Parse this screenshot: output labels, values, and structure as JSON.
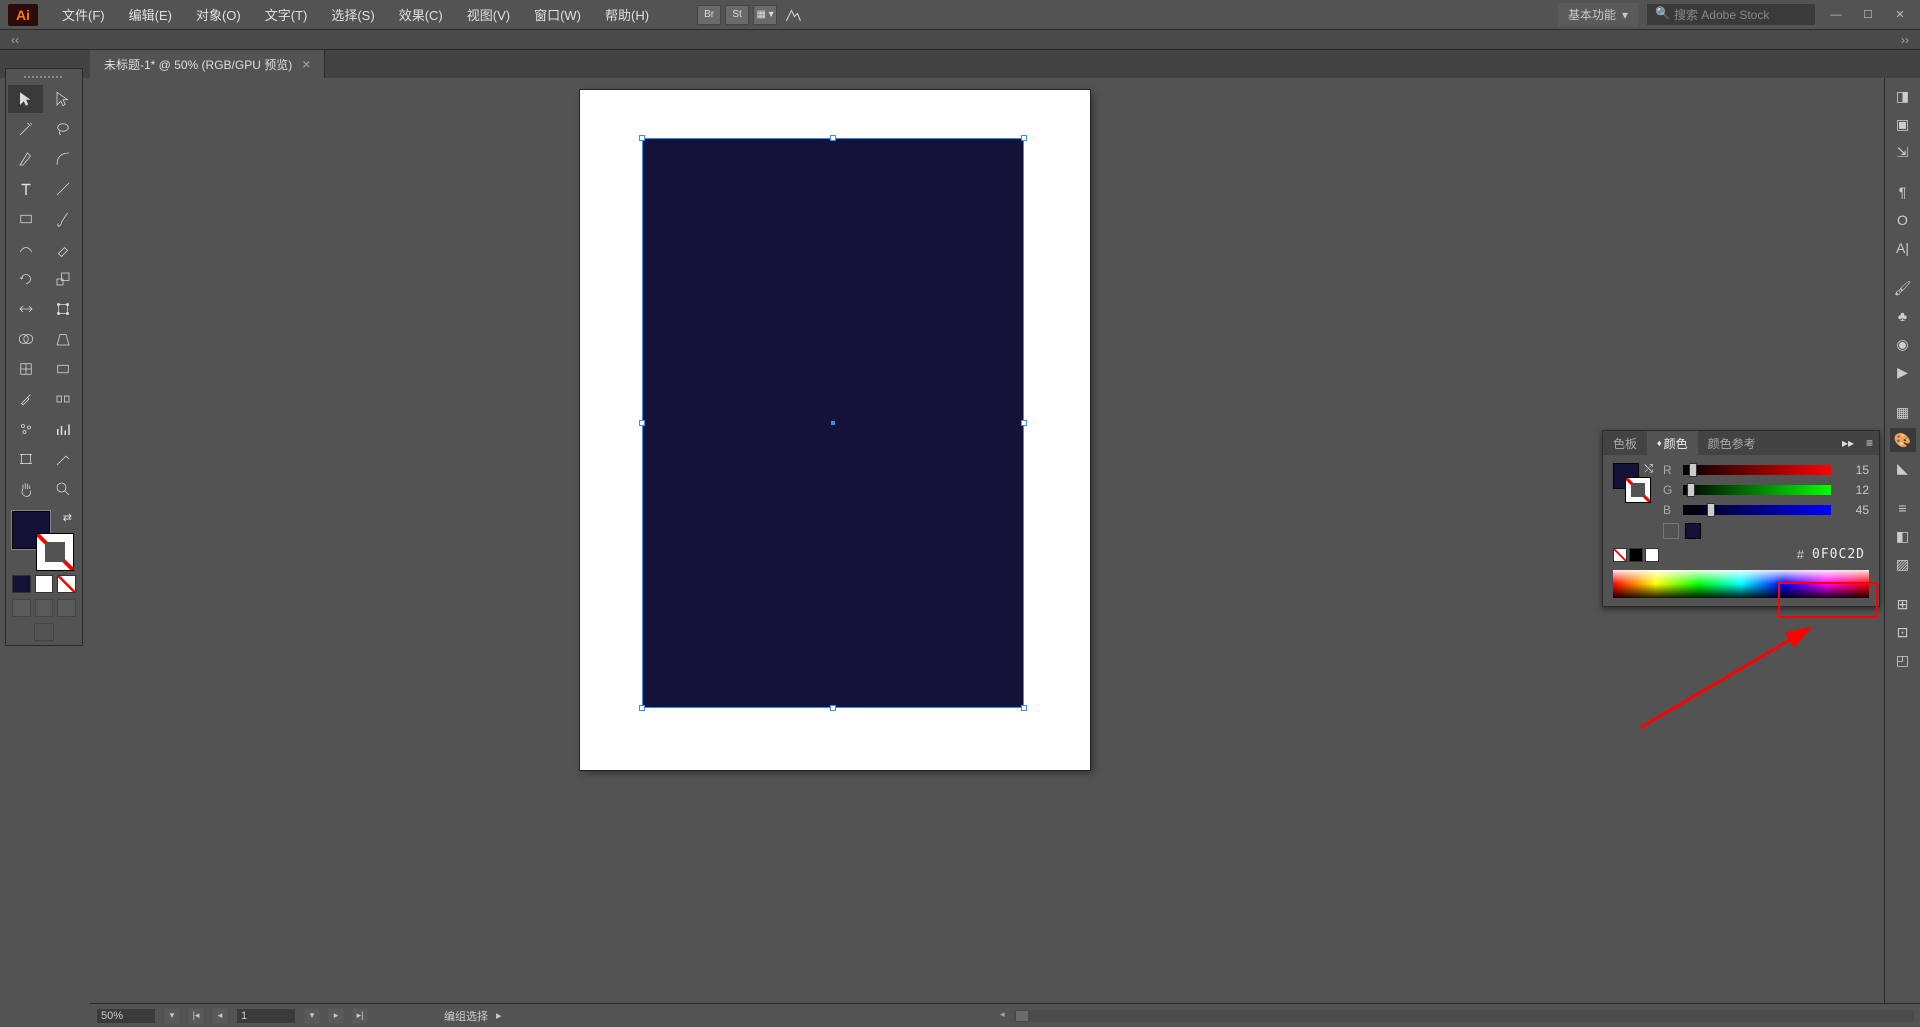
{
  "menubar": {
    "items": [
      "文件(F)",
      "编辑(E)",
      "对象(O)",
      "文字(T)",
      "选择(S)",
      "效果(C)",
      "视图(V)",
      "窗口(W)",
      "帮助(H)"
    ],
    "br_label": "Br",
    "st_label": "St",
    "workspace": "基本功能",
    "search_placeholder": "搜索 Adobe Stock"
  },
  "document": {
    "tab_title": "未标题-1* @ 50% (RGB/GPU 预览)"
  },
  "artboard": {
    "shape_fill": "#15123a"
  },
  "color_panel": {
    "tabs": [
      "色板",
      "颜色",
      "颜色参考"
    ],
    "active_tab": 1,
    "channels": {
      "R": 15,
      "G": 12,
      "B": 45
    },
    "hex": "0F0C2D"
  },
  "status": {
    "zoom": "50%",
    "page": "1",
    "selection_label": "编组选择"
  }
}
